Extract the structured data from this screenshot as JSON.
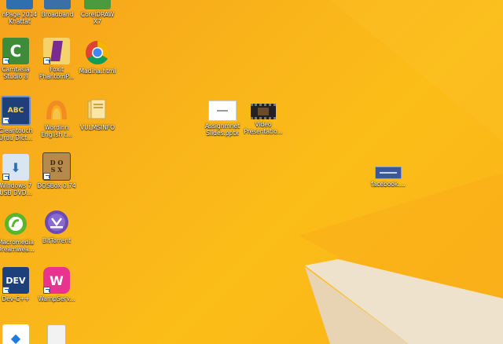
{
  "desktop": {
    "icons": [
      {
        "id": "inpage",
        "label": "nPage 2014\nKhattat",
        "icon": "inpage-icon"
      },
      {
        "id": "broadband",
        "label": "Broadband",
        "icon": "broadband-icon"
      },
      {
        "id": "coreldraw",
        "label": "CorelDRAW\nX7",
        "icon": "coreldraw-icon"
      },
      {
        "id": "camtasia",
        "label": "Camtasia\nStudio 8",
        "icon": "camtasia-icon"
      },
      {
        "id": "foxit",
        "label": "Foxit\nPhantomP...",
        "icon": "foxit-icon"
      },
      {
        "id": "madiha",
        "label": "Madiha.html",
        "icon": "chrome-icon"
      },
      {
        "id": "cleantouch",
        "label": "Cleantouch\nUrdu Dict...",
        "icon": "cleantouch-icon"
      },
      {
        "id": "wordinn",
        "label": "Wordinn\nEnglish t...",
        "icon": "wordinn-icon"
      },
      {
        "id": "vulms",
        "label": "VULMSINFO",
        "icon": "folder-icon"
      },
      {
        "id": "win7usb",
        "label": "Windows 7\nUSB DVD...",
        "icon": "win7usb-icon"
      },
      {
        "id": "dosbox",
        "label": "DOSBox 0.74",
        "icon": "dosbox-icon"
      },
      {
        "id": "dreamweaver",
        "label": "Macromedia\nDreamwea...",
        "icon": "dreamweaver-icon"
      },
      {
        "id": "bittorrent",
        "label": "BitTorrent",
        "icon": "bittorrent-icon"
      },
      {
        "id": "devcpp",
        "label": "Dev-C++",
        "icon": "devcpp-icon"
      },
      {
        "id": "wampserver",
        "label": "WampServ...",
        "icon": "wampserver-icon"
      },
      {
        "id": "assignment",
        "label": "Assignmnet\nSlides.pptx",
        "icon": "pptx-icon"
      },
      {
        "id": "video",
        "label": "Video\nPresentatio...",
        "icon": "video-icon"
      },
      {
        "id": "facebook",
        "label": "facebook....",
        "icon": "facebook-icon"
      },
      {
        "id": "dropbox",
        "label": "",
        "icon": "dropbox-icon"
      },
      {
        "id": "document",
        "label": "",
        "icon": "document-icon"
      }
    ]
  },
  "colors": {
    "background": "#fbbd18",
    "accent_shape": "#f0dfc4"
  }
}
